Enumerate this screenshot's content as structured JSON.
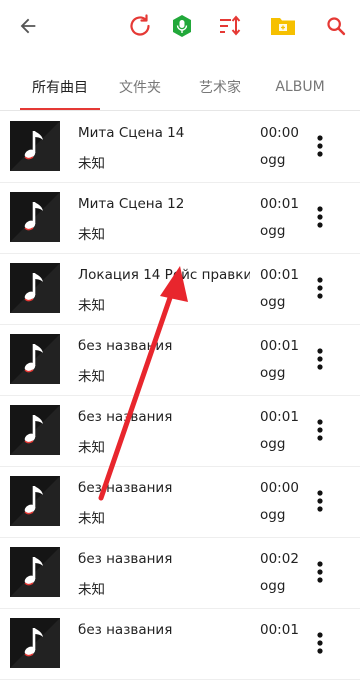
{
  "toolbar": {
    "back_icon": "arrow-left-icon",
    "refresh_icon": "refresh-icon",
    "mic_icon": "microphone-badge-icon",
    "sort_icon": "sort-icon",
    "folder_icon": "folder-icon",
    "search_icon": "search-icon",
    "accent": "#e53935",
    "mic_color": "#22a83a",
    "folder_color": "#f6c000"
  },
  "tabs": [
    {
      "label": "所有曲目",
      "active": true
    },
    {
      "label": "文件夹",
      "active": false
    },
    {
      "label": "艺术家",
      "active": false
    },
    {
      "label": "ALBUM",
      "active": false
    }
  ],
  "tracks": [
    {
      "title": "Мита Сцена 14",
      "artist": "未知",
      "duration": "00:00",
      "format": "ogg"
    },
    {
      "title": "Мита Сцена 12",
      "artist": "未知",
      "duration": "00:01",
      "format": "ogg"
    },
    {
      "title": "Локация 14 Рейс правки",
      "artist": "未知",
      "duration": "00:01",
      "format": "ogg"
    },
    {
      "title": "без названия",
      "artist": "未知",
      "duration": "00:01",
      "format": "ogg"
    },
    {
      "title": "без названия",
      "artist": "未知",
      "duration": "00:01",
      "format": "ogg"
    },
    {
      "title": "без названия",
      "artist": "未知",
      "duration": "00:00",
      "format": "ogg"
    },
    {
      "title": "без названия",
      "artist": "未知",
      "duration": "00:02",
      "format": "ogg"
    },
    {
      "title": "без названия",
      "artist": "",
      "duration": "00:01",
      "format": ""
    }
  ],
  "annotation_color": "#e8262d"
}
